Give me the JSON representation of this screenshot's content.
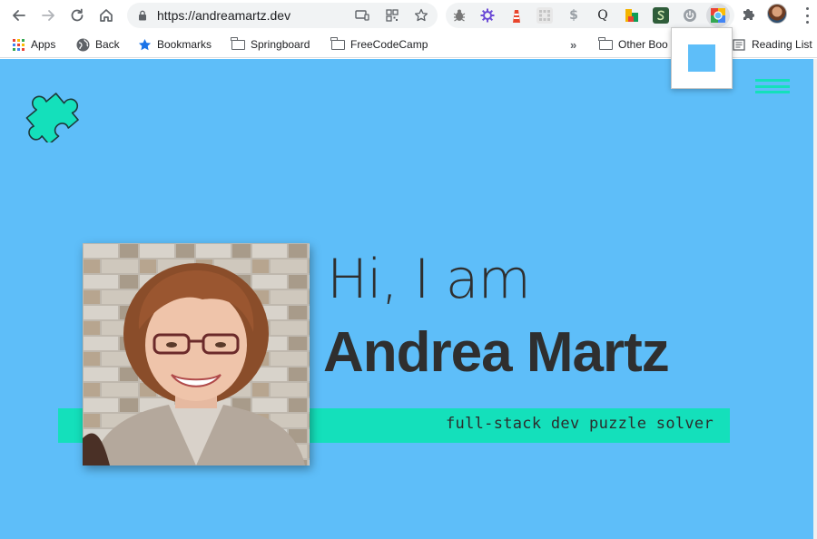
{
  "browser": {
    "url": "https://andreamartz.dev",
    "extensions": [
      {
        "name": "bug-extension-icon",
        "glyph": "✱",
        "color": "#8c8c8c"
      },
      {
        "name": "purple-gear-extension-icon",
        "glyph": "✺",
        "color": "#6c4bd6"
      },
      {
        "name": "red-lighthouse-extension-icon",
        "glyph": "▲",
        "color": "#e8452c"
      },
      {
        "name": "grid-extension-icon",
        "glyph": "▦",
        "color": "#d0d0d0"
      },
      {
        "name": "dollar-extension-icon",
        "glyph": "$",
        "color": "#9aa0a6"
      },
      {
        "name": "q-extension-icon",
        "glyph": "Q",
        "color": "#ffffff"
      },
      {
        "name": "color-blocks-extension-icon",
        "glyph": "▙",
        "color": "#f4b400"
      },
      {
        "name": "dark-s-extension-icon",
        "glyph": "S",
        "color": "#2f5d3a"
      },
      {
        "name": "power-extension-icon",
        "glyph": "⏻",
        "color": "#9aa0a6"
      },
      {
        "name": "color-picker-extension-icon",
        "glyph": "◉",
        "color": "#ea4335"
      }
    ]
  },
  "bookmarks": {
    "apps": "Apps",
    "back": "Back",
    "bookmarks": "Bookmarks",
    "springboard": "Springboard",
    "freecodecamp": "FreeCodeCamp",
    "overflow": "»",
    "other": "Other Boo",
    "reading_list": "Reading List"
  },
  "page": {
    "greeting": "Hi, I am",
    "name": "Andrea Martz",
    "tagline": "full-stack dev puzzle solver"
  },
  "colors": {
    "background": "#5ebef9",
    "accent": "#14e0bb",
    "text": "#2f2f2f"
  }
}
